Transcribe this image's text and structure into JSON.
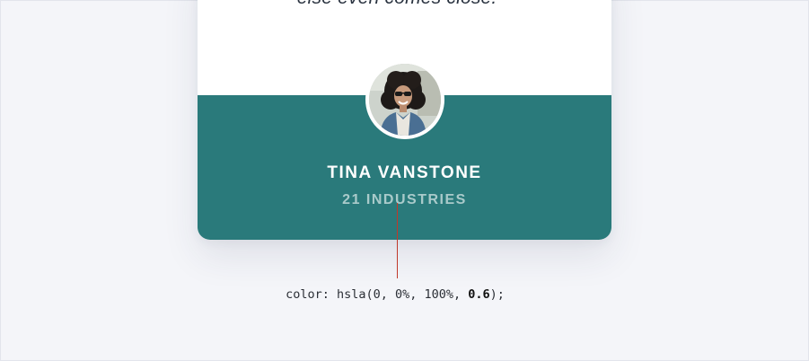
{
  "testimonial": {
    "quote_fragment": "else even comes close.",
    "quote_mark": "”",
    "author_name": "TINA VANSTONE",
    "author_company": "21 INDUSTRIES"
  },
  "annotation": {
    "code_prefix": "color: hsla(0, 0%, 100%, ",
    "code_value": "0.6",
    "code_suffix": ");"
  },
  "colors": {
    "page_background": "#f4f5f9",
    "card_top": "#ffffff",
    "card_bottom_teal": "#2a7a7b",
    "name_text": "#ffffff",
    "company_text": "hsla(0, 0%, 100%, 0.6)",
    "quote_mark": "#8fd0d4",
    "pointer_line": "#c0392b"
  },
  "icons": {
    "avatar": "avatar-photo"
  }
}
